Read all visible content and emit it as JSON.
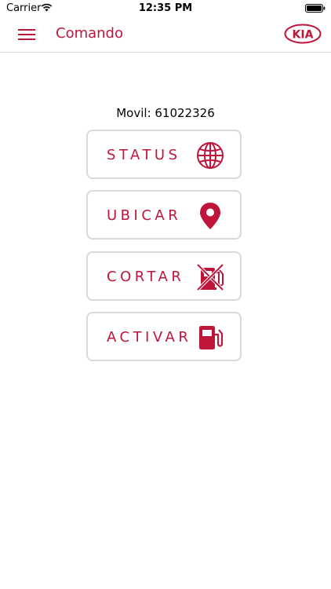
{
  "status_bar": {
    "carrier": "Carrier",
    "time": "12:35 PM"
  },
  "nav": {
    "title": "Comando",
    "menu_icon": "hamburger-menu-icon",
    "logo": "KIA"
  },
  "main": {
    "movil_label": "Movil: 61022326",
    "buttons": [
      {
        "label": "STATUS",
        "icon": "globe-icon"
      },
      {
        "label": "UBICAR",
        "icon": "location-pin-icon"
      },
      {
        "label": "CORTAR",
        "icon": "fuel-pump-off-icon"
      },
      {
        "label": "ACTIVAR",
        "icon": "fuel-pump-icon"
      }
    ]
  },
  "colors": {
    "accent": "#c0153a",
    "button_border": "#d9d9d9",
    "divider": "#dcdcdc"
  }
}
